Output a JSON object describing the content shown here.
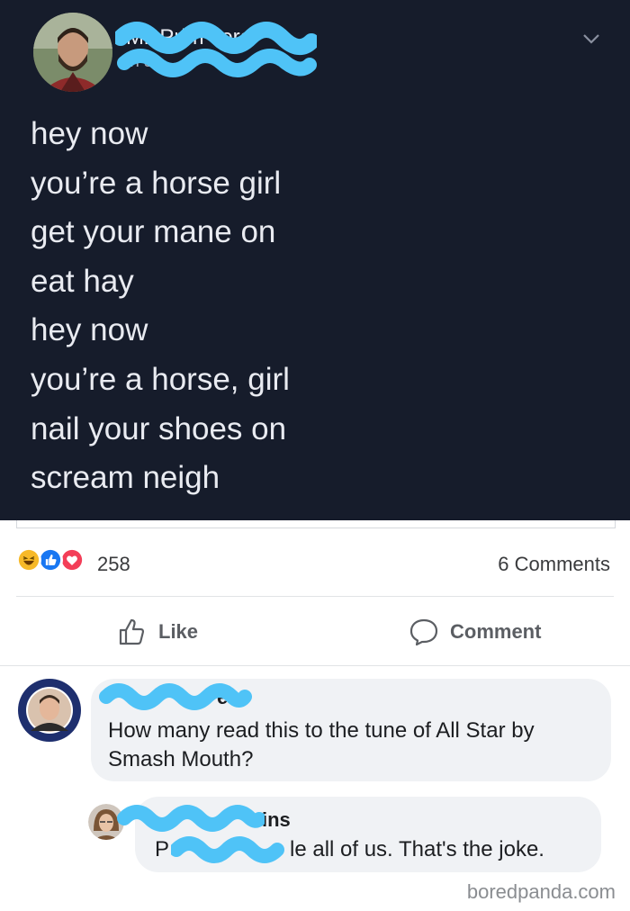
{
  "post": {
    "author_name_visible": "Mil Prim vera",
    "author_sub_visible": "in sc",
    "lines": [
      "hey now",
      "you’re a horse girl",
      "get your mane on",
      "eat hay",
      "hey now",
      "you’re a horse, girl",
      "nail your shoes on",
      "scream neigh"
    ]
  },
  "reactions": {
    "count": "258",
    "comments": "6 Comments",
    "icons": [
      "haha-icon",
      "like-icon",
      "love-icon"
    ]
  },
  "actions": {
    "like_label": "Like",
    "comment_label": "Comment"
  },
  "comments": [
    {
      "name_visible": "e",
      "text": "How many read this to the tune of All Star by Smash Mouth?"
    },
    {
      "name_visible": "ins",
      "text_prefix": "P",
      "text_suffix": "le all of us. That's the joke."
    }
  ],
  "watermark": "boredpanda.com",
  "colors": {
    "dark_bg": "#161c2b",
    "redaction": "#4fc3f7",
    "like_blue": "#1877f2",
    "love_red": "#f33e58",
    "haha_yellow": "#f7b928"
  }
}
